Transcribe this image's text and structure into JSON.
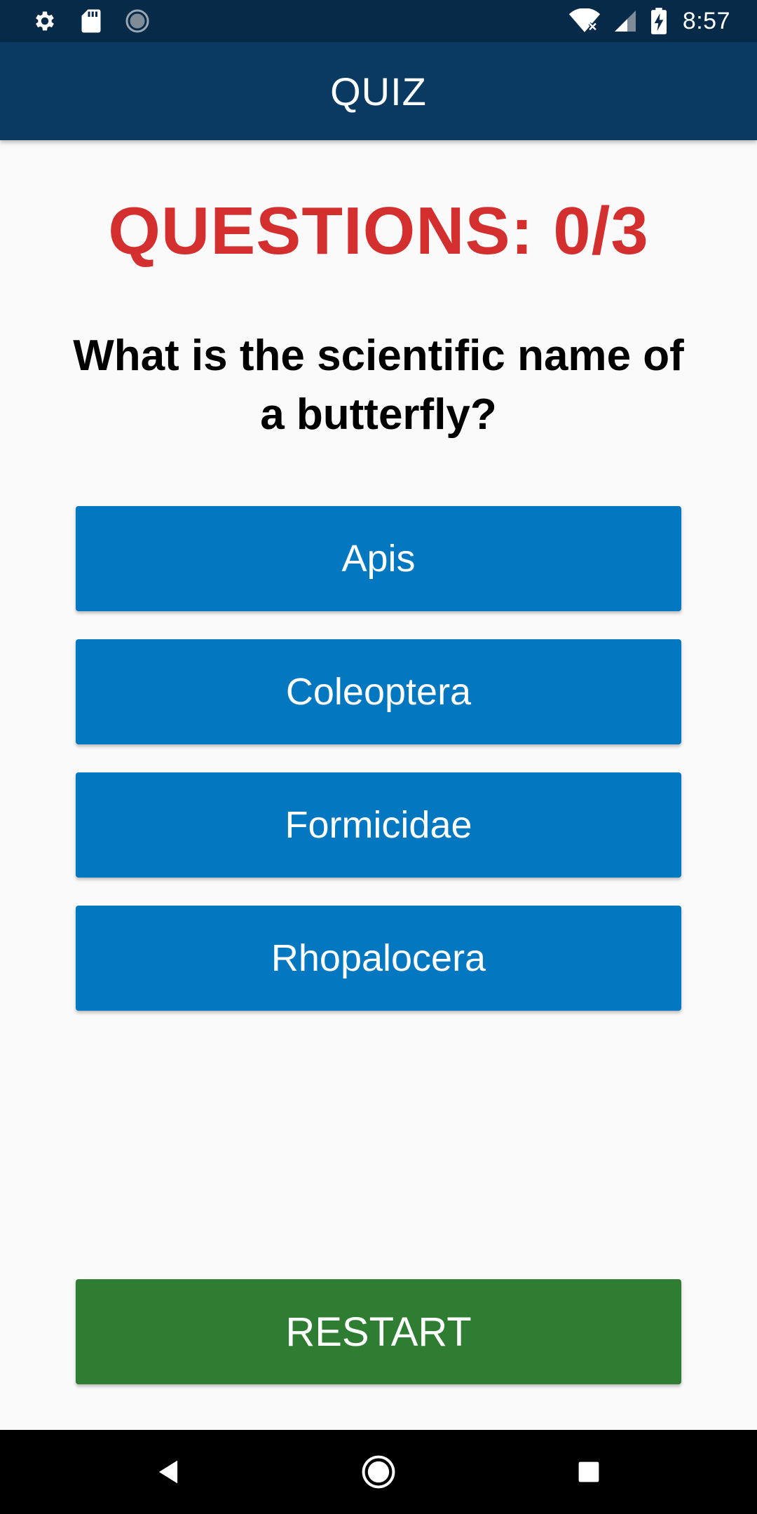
{
  "status_bar": {
    "time": "8:57",
    "left_icons": [
      "settings-gear-icon",
      "sd-card-icon",
      "sync-circle-icon"
    ],
    "right_icons": [
      "wifi-no-internet-icon",
      "cellular-signal-icon",
      "battery-charging-icon"
    ]
  },
  "app_bar": {
    "title": "QUIZ"
  },
  "quiz": {
    "progress_label": "QUESTIONS: 0/3",
    "question": "What is the scientific name of a butterfly?",
    "answers": [
      {
        "label": "Apis"
      },
      {
        "label": "Coleoptera"
      },
      {
        "label": "Formicidae"
      },
      {
        "label": "Rhopalocera"
      }
    ],
    "restart_label": "RESTART"
  },
  "nav_bar": {
    "buttons": [
      "back-icon",
      "home-icon",
      "recents-icon"
    ]
  },
  "colors": {
    "status_bar": "#062a47",
    "app_bar": "#0a3a61",
    "progress_text": "#d32f2f",
    "answer_button": "#0377bf",
    "restart_button": "#2e7d32",
    "background": "#fafafa"
  }
}
